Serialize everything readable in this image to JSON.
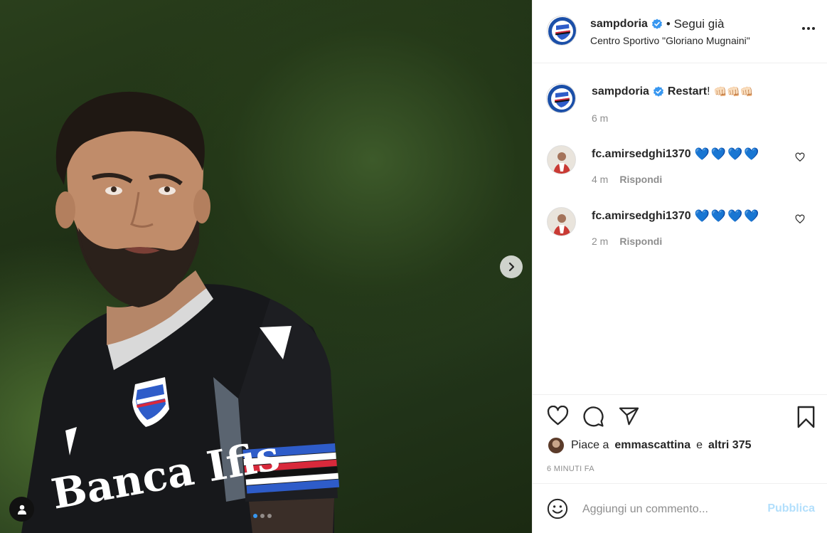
{
  "post": {
    "account": "sampdoria",
    "follow_status": "• Segui già",
    "location": "Centro Sportivo \"Gloriano Mugnaini\"",
    "caption_bold": "Restart",
    "caption_rest": "!",
    "caption_emojis": "👊🏻👊🏻👊🏻",
    "caption_time": "6 m",
    "carousel": {
      "slide_count": 3,
      "active_slide": 1
    },
    "jersey_text": "Banca Ifis"
  },
  "comments": [
    {
      "user": "fc.amirsedghi1370",
      "text": "💙💙💙💙",
      "time": "4 m",
      "reply_label": "Rispondi"
    },
    {
      "user": "fc.amirsedghi1370",
      "text": "💙💙💙💙",
      "time": "2 m",
      "reply_label": "Rispondi"
    }
  ],
  "likes": {
    "prefix": "Piace a",
    "liker": "emmascattina",
    "conj": "e",
    "others": "altri 375"
  },
  "posted_ago": "6 MINUTI FA",
  "add_comment": {
    "placeholder": "Aggiungi un commento...",
    "publish_label": "Pubblica"
  },
  "colors": {
    "verified": "#3897f0",
    "publish_disabled": "#b2dffc",
    "secondary_text": "#8e8e8e",
    "heart_blue": "#1877f2"
  },
  "icons": [
    "chevron-right-icon",
    "user-tag-icon",
    "verified-badge-icon",
    "more-icon",
    "heart-icon",
    "comment-icon",
    "share-icon",
    "bookmark-icon",
    "emoji-icon"
  ]
}
